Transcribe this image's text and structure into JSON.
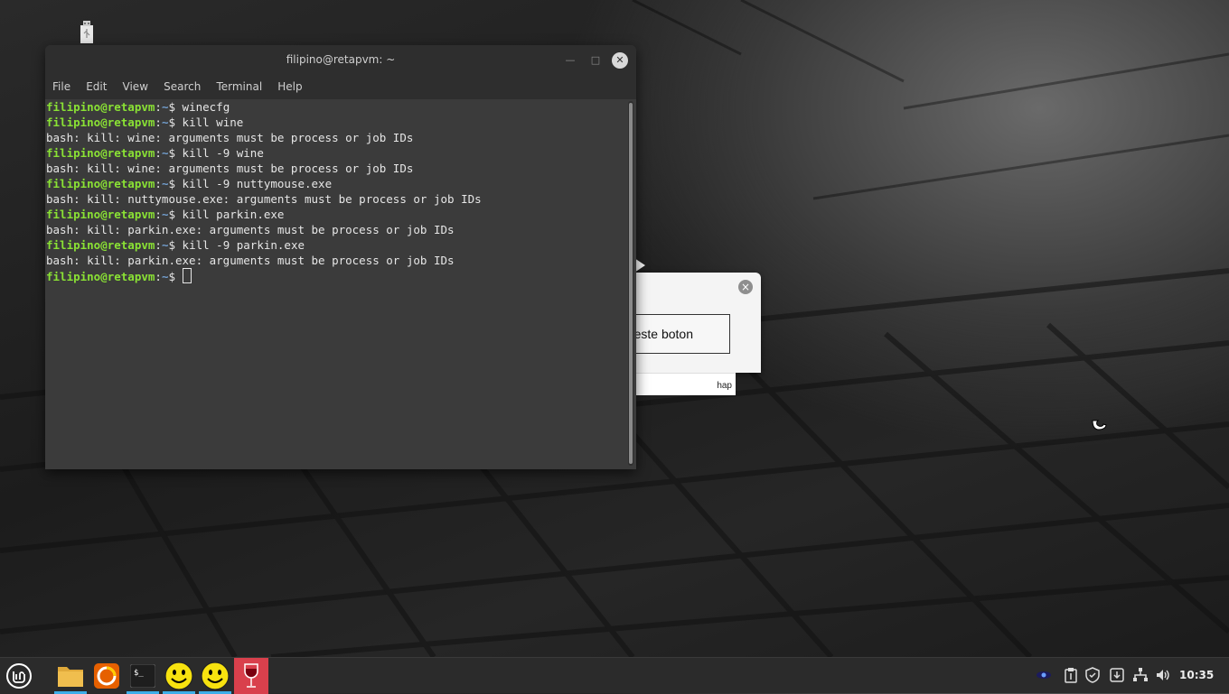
{
  "terminal": {
    "title": "filipino@retapvm: ~",
    "menu": [
      "File",
      "Edit",
      "View",
      "Search",
      "Terminal",
      "Help"
    ],
    "prompt_user": "filipino@retapvm",
    "prompt_sep": ":",
    "prompt_path": "~",
    "prompt_dollar": "$ ",
    "lines": [
      {
        "kind": "cmd",
        "text": "winecfg"
      },
      {
        "kind": "cmd",
        "text": "kill wine"
      },
      {
        "kind": "out",
        "text": "bash: kill: wine: arguments must be process or job IDs"
      },
      {
        "kind": "cmd",
        "text": "kill -9 wine"
      },
      {
        "kind": "out",
        "text": "bash: kill: wine: arguments must be process or job IDs"
      },
      {
        "kind": "cmd",
        "text": "kill -9 nuttymouse.exe"
      },
      {
        "kind": "out",
        "text": "bash: kill: nuttymouse.exe: arguments must be process or job IDs"
      },
      {
        "kind": "cmd",
        "text": "kill parkin.exe"
      },
      {
        "kind": "out",
        "text": "bash: kill: parkin.exe: arguments must be process or job IDs"
      },
      {
        "kind": "cmd",
        "text": "kill -9 parkin.exe"
      },
      {
        "kind": "out",
        "text": "bash: kill: parkin.exe: arguments must be process or job IDs"
      },
      {
        "kind": "cmd",
        "text": ""
      }
    ]
  },
  "dialog": {
    "button_label": "este boton",
    "strip_label": "hap"
  },
  "taskbar": {
    "apps": [
      "mint-menu-icon",
      "files-icon",
      "firefox-icon",
      "terminal-icon",
      "smiley-icon",
      "smiley-icon",
      "wine-icon"
    ],
    "tray": [
      "eye-icon",
      "clipboard-icon",
      "shield-icon",
      "update-icon",
      "network-icon",
      "volume-icon"
    ],
    "clock": "10:35"
  },
  "colors": {
    "prompt_user": "#8ae234",
    "prompt_path": "#729fcf",
    "terminal_bg": "#3b3b3b",
    "active_indicator": "#3daee9"
  }
}
